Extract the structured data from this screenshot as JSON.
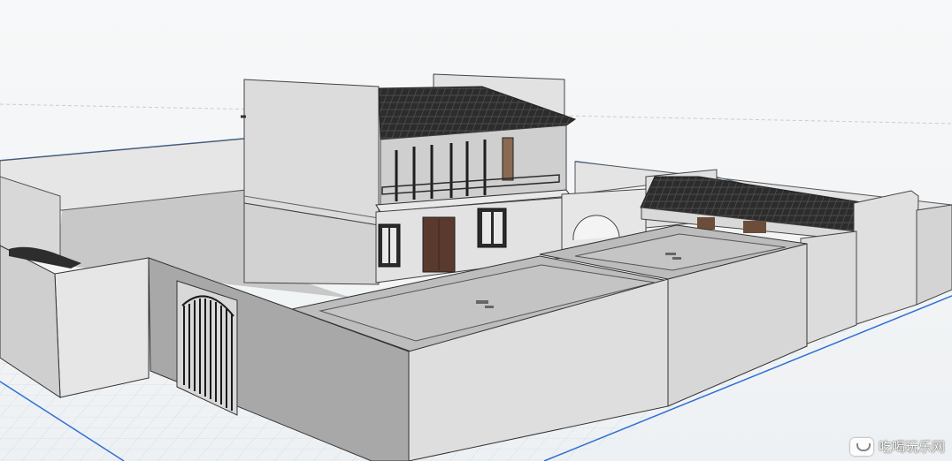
{
  "watermark": {
    "text": "吃喝玩乐网",
    "logo": "cloud-logo-icon"
  },
  "scene": {
    "type": "3d-model-viewport",
    "subject": "courtyard-house-model",
    "colors": {
      "sky": "#f3f5f6",
      "grid_line": "#c9d6e6",
      "axis_blue": "#2f6fd6",
      "wall_light": "#ececec",
      "wall_mid": "#cfcfcf",
      "wall_dark": "#9d9d9d",
      "roof": "#2c2c2c",
      "door": "#5a3a2f"
    }
  }
}
